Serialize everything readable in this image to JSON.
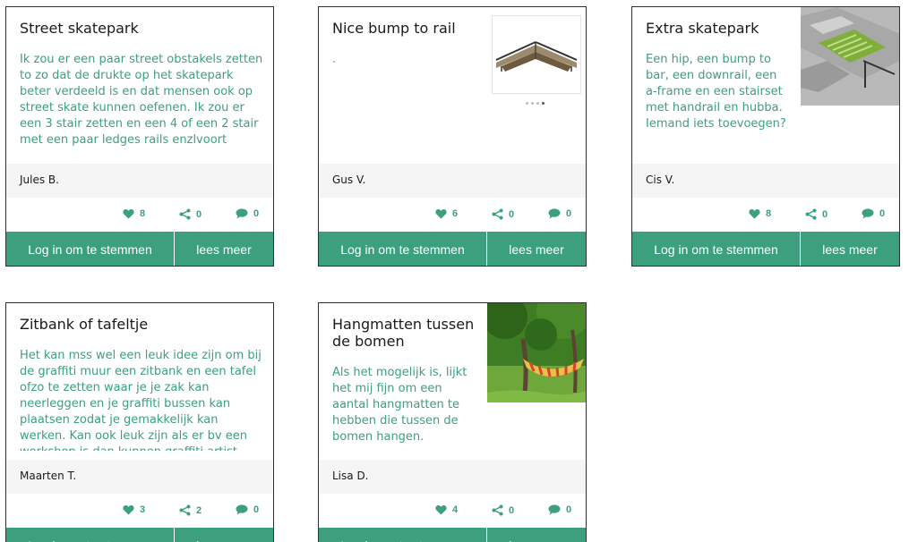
{
  "labels": {
    "vote": "Log in om te stemmen",
    "more": "lees meer"
  },
  "colors": {
    "accent": "#3c9f7e",
    "border": "#2f2f2f",
    "author_bg": "#f5f5f5"
  },
  "icons": {
    "like": "heart-icon",
    "share": "share-icon",
    "comment": "comment-icon"
  },
  "cards": [
    {
      "title": "Street skatepark",
      "description": "Ik zou er een paar street obstakels zetten to zo dat de drukte op het skatepark beter verdeeld is en dat mensen ook op street skate kunnen oefenen. Ik zou er een 3 stair zetten en een 4 of een 2 stair met een paar ledges rails enzlvoort",
      "author": "Jules B.",
      "likes": "8",
      "shares": "0",
      "comments": "0"
    },
    {
      "title": "Nice bump to rail",
      "description": ".",
      "author": "Gus V.",
      "likes": "6",
      "shares": "0",
      "comments": "0",
      "image": "bump-to-rail-image"
    },
    {
      "title": "Extra skatepark",
      "description": "Een hip, een bump to bar, een downrail, een a-frame en een stairset met handrail en hubba. Iemand iets toevoegen?",
      "author": "Cis V.",
      "likes": "8",
      "shares": "0",
      "comments": "0",
      "image": "skatepark-render-image"
    },
    {
      "title": "Zitbank of tafeltje",
      "description": "Het kan mss wel een leuk idee zijn om bij de graffiti muur een zitbank en een tafel ofzo te zetten waar je je zak kan neerleggen en je graffiti bussen kan plaatsen zodat je gemakkelijk kan werken. Kan ook leuk zijn als er bv een workshop is dan kunnen graffiti artist",
      "author": "Maarten T.",
      "likes": "3",
      "shares": "2",
      "comments": "0"
    },
    {
      "title": "Hangmatten tussen de bomen",
      "description": "Als het mogelijk is, lijkt het mij fijn om een aantal hangmatten te hebben die tussen de bomen hangen.",
      "author": "Lisa D.",
      "likes": "4",
      "shares": "0",
      "comments": "0",
      "image": "hammock-photo"
    }
  ]
}
